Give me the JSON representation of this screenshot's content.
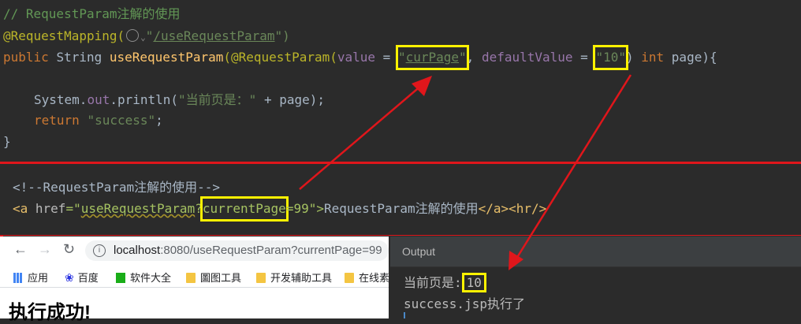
{
  "java": {
    "comment": "// RequestParam注解的使用",
    "mapping_annotation": "@RequestMapping(",
    "mapping_path": "/useRequestParam",
    "mapping_close": "\")",
    "kw_public": "public",
    "type_string": "String",
    "method_name": "useRequestParam",
    "param_open": "(@RequestParam(",
    "value_key": "value",
    "eq": " = ",
    "value_val": "curPage",
    "default_key": "defaultValue",
    "default_val": "10",
    "kw_int": "int",
    "param_name": "page",
    "param_close": "){",
    "sys_prefix": "System.",
    "sys_out": "out",
    "sys_println": ".println(",
    "print_str": "\"当前页是：\"",
    "print_plus": " + page);",
    "kw_return": "return",
    "return_str": "\"success\"",
    "semicolon": ";",
    "brace_close": "}"
  },
  "jsp": {
    "comment": "<!--RequestParam注解的使用-->",
    "a_open": "<a ",
    "href_attr": "href",
    "href_eq": "=\"",
    "href_path": "useRequestParam",
    "href_q": "?",
    "href_param": "currentPage",
    "href_val": "=99",
    "href_close": "\">",
    "link_text": "RequestParam注解的使用",
    "a_close": "</a>",
    "hr_tag": "<hr/>"
  },
  "browser": {
    "url_host": "localhost",
    "url_rest": ":8080/useRequestParam?currentPage=99",
    "bookmarks": [
      "应用",
      "百度",
      "软件大全",
      "圖图工具",
      "开发辅助工具",
      "在线素"
    ],
    "heading": "执行成功!"
  },
  "output_panel": {
    "title": "Output",
    "line1_label": "当前页是:",
    "line1_value": "10",
    "line2": "success.jsp执行了"
  },
  "colors": {
    "highlight": "#fff200",
    "arrow": "#e0161b"
  }
}
